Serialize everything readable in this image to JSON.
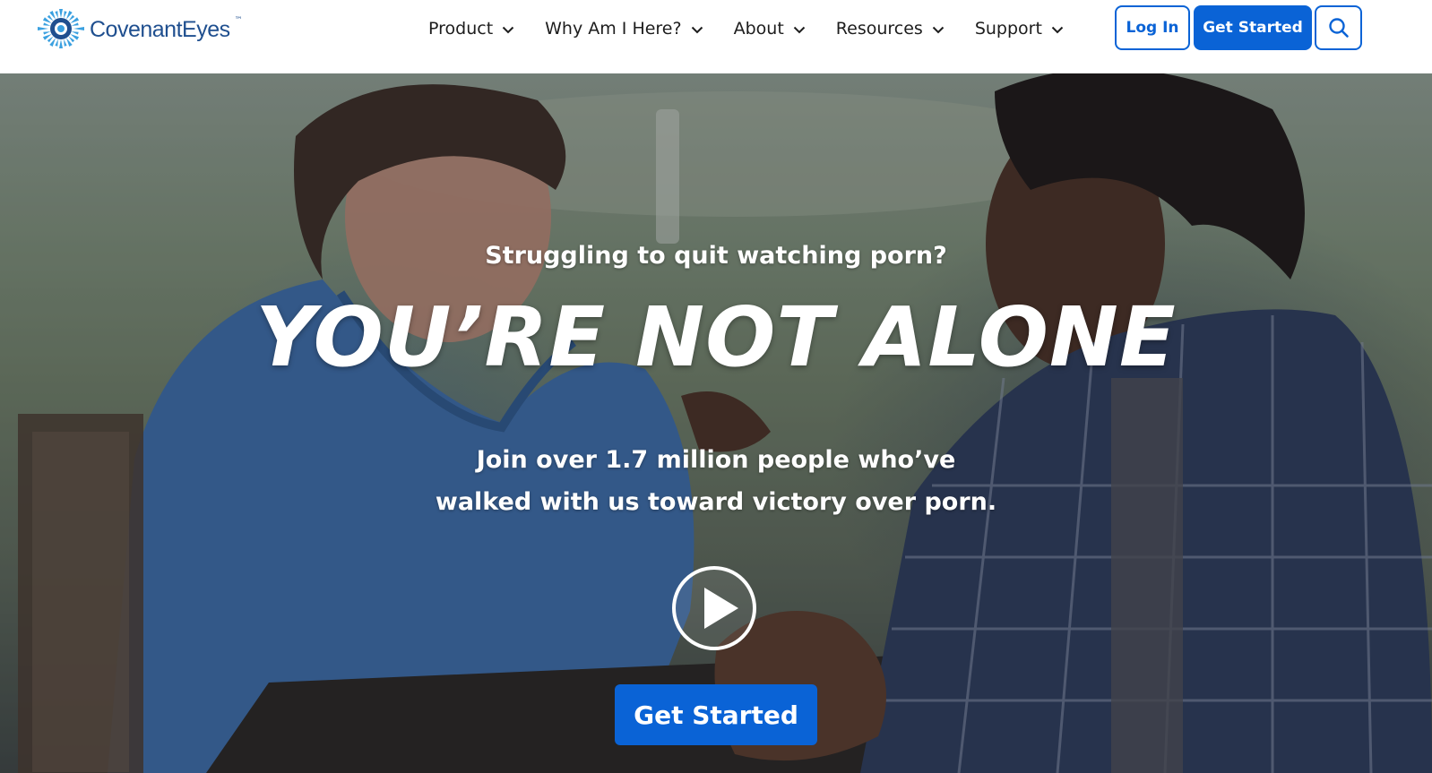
{
  "header": {
    "logo": {
      "text": "CovenantEyes",
      "tm": "™",
      "icon": "eye-sunburst-icon"
    },
    "nav": [
      {
        "label": "Product",
        "icon": "chevron-down-icon"
      },
      {
        "label": "Why Am I Here?",
        "icon": "chevron-down-icon"
      },
      {
        "label": "About",
        "icon": "chevron-down-icon"
      },
      {
        "label": "Resources",
        "icon": "chevron-down-icon"
      },
      {
        "label": "Support",
        "icon": "chevron-down-icon"
      }
    ],
    "login_label": "Log In",
    "get_started_label": "Get Started",
    "search_icon": "search-icon"
  },
  "hero": {
    "subtitle": "Struggling to quit watching porn?",
    "title": "YOU’RE NOT ALONE",
    "body_line1": "Join over 1.7 million people who’ve",
    "body_line2": "walked with us toward victory over porn.",
    "play_icon": "play-icon",
    "cta_label": "Get Started"
  },
  "colors": {
    "brand_blue": "#0a63d6",
    "logo_blue": "#1f4f8f",
    "hero_text": "#ffffff"
  }
}
